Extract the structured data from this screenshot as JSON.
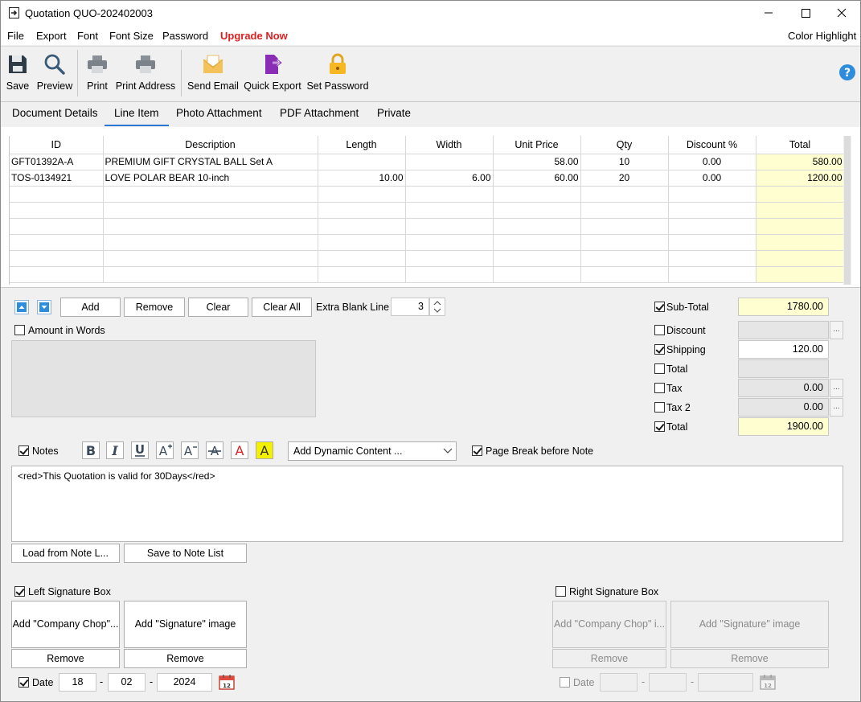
{
  "title": "Quotation QUO-202402003",
  "menu": {
    "file": "File",
    "export": "Export",
    "font": "Font",
    "font_size": "Font Size",
    "password": "Password",
    "upgrade": "Upgrade Now",
    "color_highlight": "Color Highlight"
  },
  "toolbar": {
    "save": "Save",
    "preview": "Preview",
    "print": "Print",
    "print_address": "Print Address",
    "send_email": "Send Email",
    "quick_export": "Quick Export",
    "set_password": "Set Password"
  },
  "tabs": [
    "Document Details",
    "Line Item",
    "Photo Attachment",
    "PDF Attachment",
    "Private"
  ],
  "grid": {
    "columns": [
      "ID",
      "Description",
      "Length",
      "Width",
      "Unit Price",
      "Qty",
      "Discount %",
      "Total"
    ],
    "rows": [
      [
        "GFT01392A-A",
        "PREMIUM GIFT CRYSTAL BALL Set A",
        "",
        "",
        "58.00",
        "10",
        "0.00",
        "580.00"
      ],
      [
        "TOS-0134921",
        "LOVE POLAR BEAR 10-inch",
        "10.00",
        "6.00",
        "60.00",
        "20",
        "0.00",
        "1200.00"
      ]
    ]
  },
  "line_controls": {
    "add": "Add",
    "remove": "Remove",
    "clear": "Clear",
    "clear_all": "Clear All",
    "extra_blank_line": "Extra Blank Line",
    "extra_blank_value": "3"
  },
  "amount_in_words": "Amount in Words",
  "totals": {
    "subtotal_label": "Sub-Total",
    "subtotal_value": "1780.00",
    "discount_label": "Discount",
    "discount_value": "",
    "shipping_label": "Shipping",
    "shipping_value": "120.00",
    "total1_label": "Total",
    "total1_value": "",
    "tax_label": "Tax",
    "tax_value": "0.00",
    "tax2_label": "Tax 2",
    "tax2_value": "0.00",
    "total_label": "Total",
    "total_value": "1900.00",
    "dots": "..."
  },
  "notes": {
    "label": "Notes",
    "dynamic_content": "Add Dynamic Content ...",
    "page_break": "Page Break before Note",
    "text": "<red>This Quotation is valid for 30Days</red>",
    "load": "Load from Note L...",
    "save": "Save to Note List"
  },
  "signature": {
    "left_label": "Left Signature Box",
    "right_label": "Right Signature Box",
    "company_chop": "Add \"Company Chop\"...",
    "company_chop_right": "Add \"Company Chop\" i...",
    "signature_image": "Add \"Signature\" image",
    "remove": "Remove",
    "date_label": "Date",
    "day": "18",
    "month": "02",
    "year": "2024",
    "sep": "-"
  },
  "colors": {
    "accent": "#2a78d4",
    "upgrade": "#e02020",
    "highlight": "#fefed0"
  }
}
